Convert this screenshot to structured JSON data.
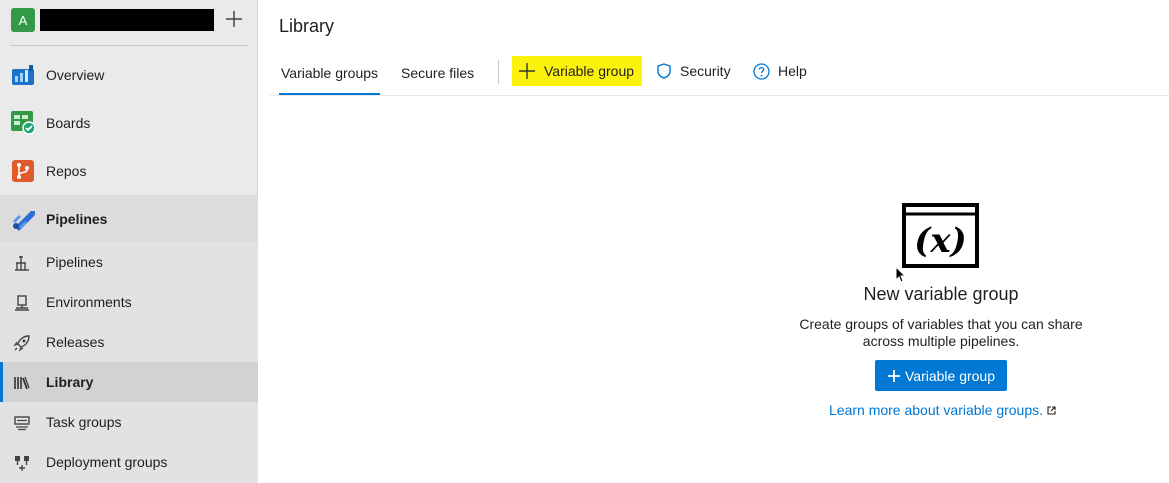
{
  "project": {
    "avatar_letter": "A",
    "add_icon": "plus-icon"
  },
  "nav": {
    "main": [
      {
        "label": "Overview",
        "icon": "overview-icon",
        "color": "#1a73c8"
      },
      {
        "label": "Boards",
        "icon": "boards-icon",
        "color": "#339947"
      },
      {
        "label": "Repos",
        "icon": "repos-icon",
        "color": "#e05b2b"
      },
      {
        "label": "Pipelines",
        "icon": "pipelines-icon",
        "color": "#2f6fd4"
      }
    ],
    "sub": [
      {
        "label": "Pipelines",
        "icon": "pipelines-sub-icon"
      },
      {
        "label": "Environments",
        "icon": "environments-icon"
      },
      {
        "label": "Releases",
        "icon": "releases-icon"
      },
      {
        "label": "Library",
        "icon": "library-icon"
      },
      {
        "label": "Task groups",
        "icon": "task-groups-icon"
      },
      {
        "label": "Deployment groups",
        "icon": "deployment-groups-icon"
      }
    ]
  },
  "page": {
    "title": "Library"
  },
  "tabs": [
    {
      "label": "Variable groups",
      "active": true
    },
    {
      "label": "Secure files",
      "active": false
    }
  ],
  "commands": {
    "add_variable_group": "Variable group",
    "security": "Security",
    "help": "Help"
  },
  "empty_state": {
    "icon_text": "(x)",
    "title": "New variable group",
    "description_line1": "Create groups of variables that you can share",
    "description_line2": "across multiple pipelines.",
    "button_label": "Variable group",
    "link_text": "Learn more about variable groups."
  },
  "colors": {
    "accent": "#0078d4",
    "highlight": "#fcf30c",
    "sidebar_bg": "#eaeaea"
  }
}
